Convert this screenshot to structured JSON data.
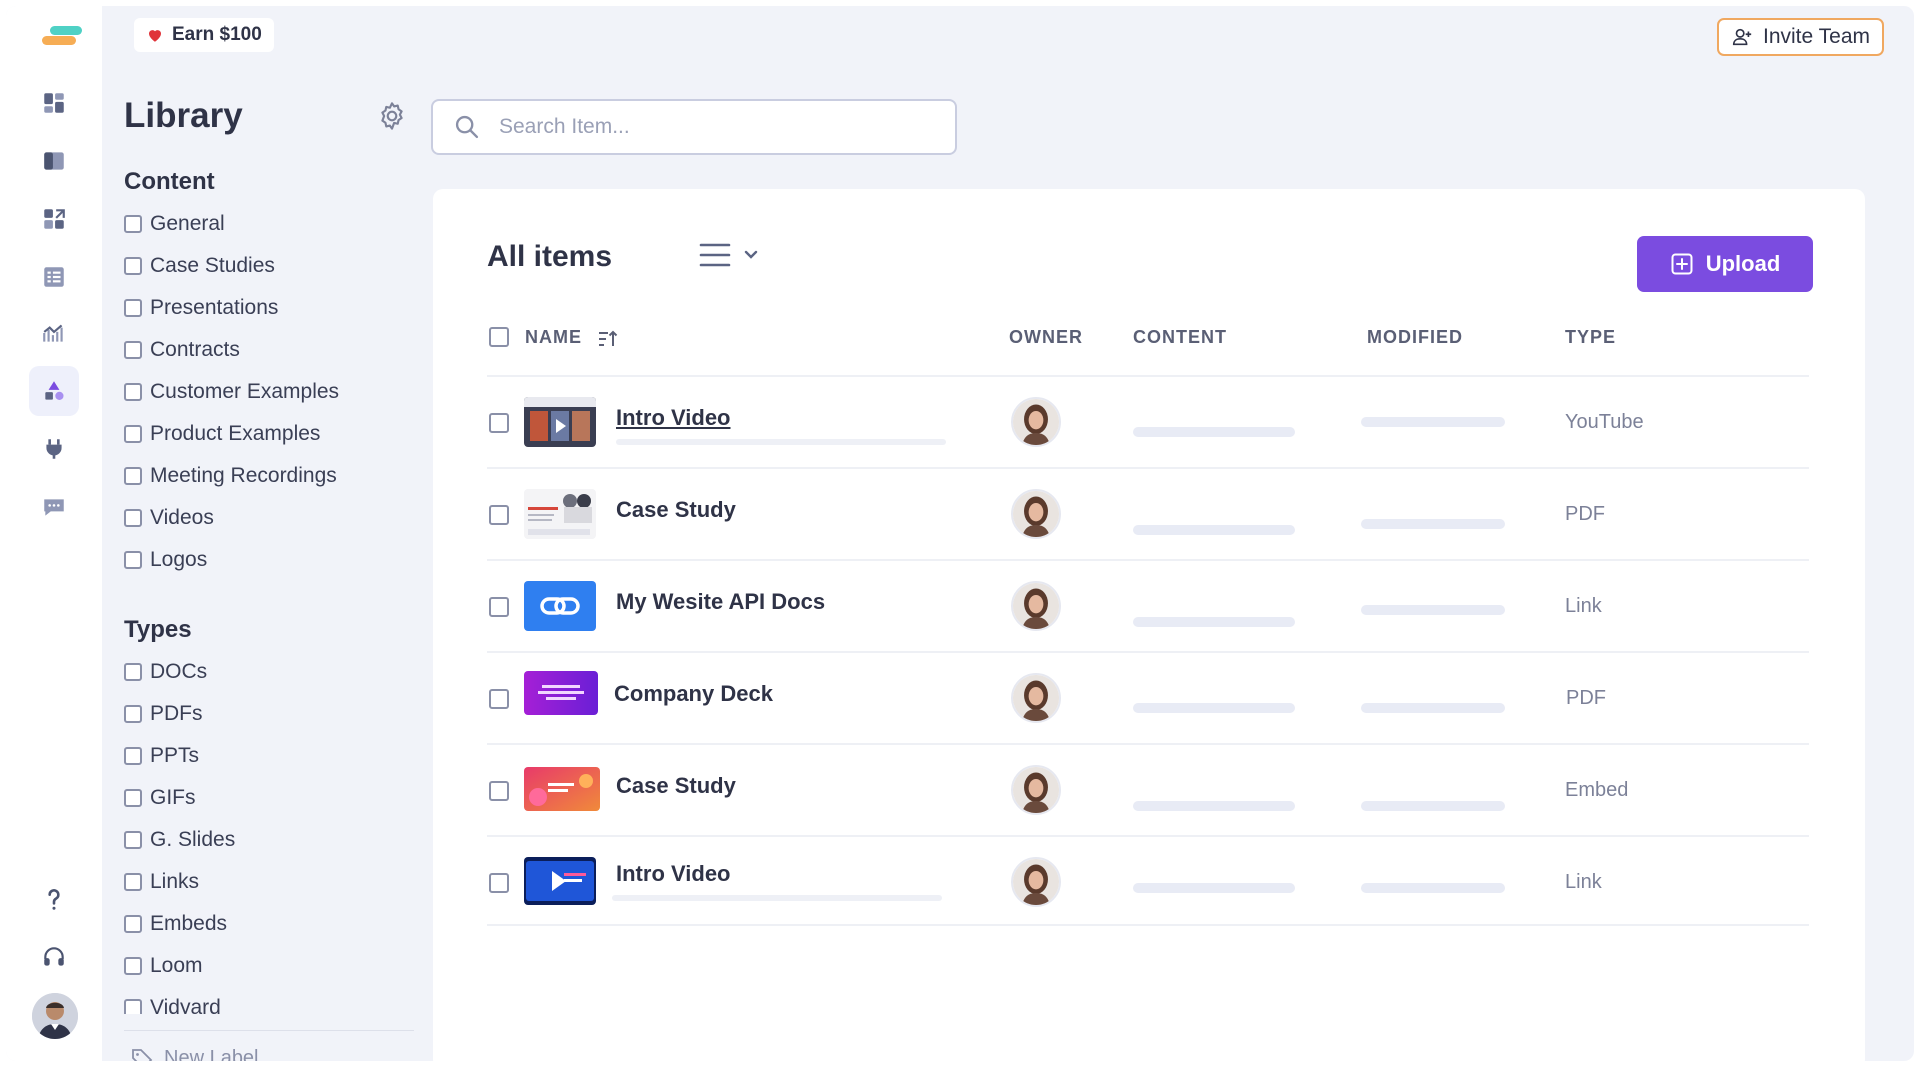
{
  "top": {
    "earn_label": "Earn $100",
    "invite_label": "Invite Team"
  },
  "rail": {
    "items": [
      "dashboard-icon",
      "book-icon",
      "widgets-icon",
      "list-icon",
      "analytics-icon",
      "shapes-icon",
      "plug-icon",
      "chat-icon"
    ],
    "active": "shapes-icon",
    "bottom": [
      "help-icon",
      "headset-icon",
      "user-avatar"
    ]
  },
  "library": {
    "title": "Library",
    "content_title": "Content",
    "content_items": [
      "General",
      "Case Studies",
      "Presentations",
      "Contracts",
      "Customer Examples",
      "Product Examples",
      "Meeting Recordings",
      "Videos",
      "Logos"
    ],
    "types_title": "Types",
    "type_items": [
      "DOCs",
      "PDFs",
      "PPTs",
      "GIFs",
      "G. Slides",
      "Links",
      "Embeds",
      "Loom",
      "Vidyard"
    ],
    "new_label": "New Label"
  },
  "search": {
    "placeholder": "Search Item..."
  },
  "main": {
    "title": "All items",
    "upload_label": "Upload",
    "columns": {
      "name": "NAME",
      "owner": "OWNER",
      "content": "CONTENT",
      "modified": "MODIFIED",
      "type": "TYPE"
    },
    "rows": [
      {
        "name": "Intro Video",
        "type": "YouTube",
        "thumb": "video-thumb"
      },
      {
        "name": "Case Study",
        "type": "PDF",
        "thumb": "doc-thumb"
      },
      {
        "name": "My Wesite API Docs",
        "type": "Link",
        "thumb": "link-thumb"
      },
      {
        "name": "Company Deck",
        "type": "PDF",
        "thumb": "deck-thumb"
      },
      {
        "name": "Case Study",
        "type": "Embed",
        "thumb": "embed-thumb"
      },
      {
        "name": "Intro Video",
        "type": "Link",
        "thumb": "play-thumb"
      }
    ]
  },
  "colors": {
    "accent": "#7b4ce0",
    "invite_border": "#f0a860",
    "link_blue": "#2f7ff0"
  }
}
